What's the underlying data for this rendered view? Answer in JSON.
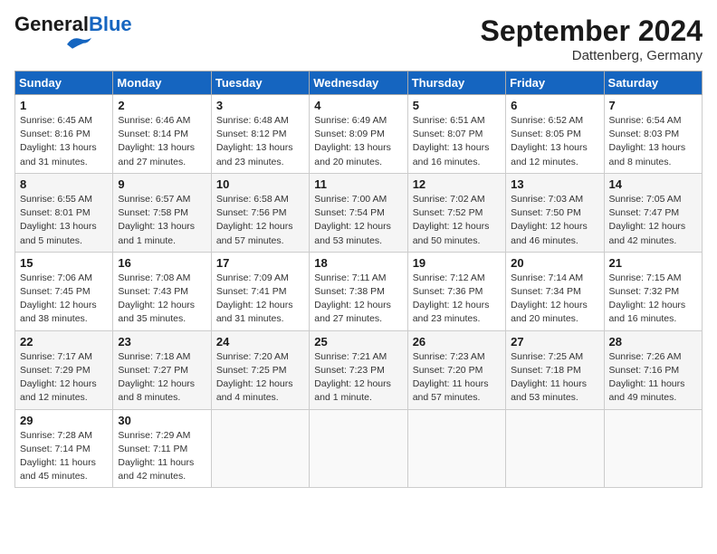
{
  "header": {
    "logo_general": "General",
    "logo_blue": "Blue",
    "month": "September 2024",
    "location": "Dattenberg, Germany"
  },
  "days_of_week": [
    "Sunday",
    "Monday",
    "Tuesday",
    "Wednesday",
    "Thursday",
    "Friday",
    "Saturday"
  ],
  "weeks": [
    [
      {
        "day": 1,
        "sunrise": "6:45 AM",
        "sunset": "8:16 PM",
        "daylight": "13 hours and 31 minutes."
      },
      {
        "day": 2,
        "sunrise": "6:46 AM",
        "sunset": "8:14 PM",
        "daylight": "13 hours and 27 minutes."
      },
      {
        "day": 3,
        "sunrise": "6:48 AM",
        "sunset": "8:12 PM",
        "daylight": "13 hours and 23 minutes."
      },
      {
        "day": 4,
        "sunrise": "6:49 AM",
        "sunset": "8:09 PM",
        "daylight": "13 hours and 20 minutes."
      },
      {
        "day": 5,
        "sunrise": "6:51 AM",
        "sunset": "8:07 PM",
        "daylight": "13 hours and 16 minutes."
      },
      {
        "day": 6,
        "sunrise": "6:52 AM",
        "sunset": "8:05 PM",
        "daylight": "13 hours and 12 minutes."
      },
      {
        "day": 7,
        "sunrise": "6:54 AM",
        "sunset": "8:03 PM",
        "daylight": "13 hours and 8 minutes."
      }
    ],
    [
      {
        "day": 8,
        "sunrise": "6:55 AM",
        "sunset": "8:01 PM",
        "daylight": "13 hours and 5 minutes."
      },
      {
        "day": 9,
        "sunrise": "6:57 AM",
        "sunset": "7:58 PM",
        "daylight": "13 hours and 1 minute."
      },
      {
        "day": 10,
        "sunrise": "6:58 AM",
        "sunset": "7:56 PM",
        "daylight": "12 hours and 57 minutes."
      },
      {
        "day": 11,
        "sunrise": "7:00 AM",
        "sunset": "7:54 PM",
        "daylight": "12 hours and 53 minutes."
      },
      {
        "day": 12,
        "sunrise": "7:02 AM",
        "sunset": "7:52 PM",
        "daylight": "12 hours and 50 minutes."
      },
      {
        "day": 13,
        "sunrise": "7:03 AM",
        "sunset": "7:50 PM",
        "daylight": "12 hours and 46 minutes."
      },
      {
        "day": 14,
        "sunrise": "7:05 AM",
        "sunset": "7:47 PM",
        "daylight": "12 hours and 42 minutes."
      }
    ],
    [
      {
        "day": 15,
        "sunrise": "7:06 AM",
        "sunset": "7:45 PM",
        "daylight": "12 hours and 38 minutes."
      },
      {
        "day": 16,
        "sunrise": "7:08 AM",
        "sunset": "7:43 PM",
        "daylight": "12 hours and 35 minutes."
      },
      {
        "day": 17,
        "sunrise": "7:09 AM",
        "sunset": "7:41 PM",
        "daylight": "12 hours and 31 minutes."
      },
      {
        "day": 18,
        "sunrise": "7:11 AM",
        "sunset": "7:38 PM",
        "daylight": "12 hours and 27 minutes."
      },
      {
        "day": 19,
        "sunrise": "7:12 AM",
        "sunset": "7:36 PM",
        "daylight": "12 hours and 23 minutes."
      },
      {
        "day": 20,
        "sunrise": "7:14 AM",
        "sunset": "7:34 PM",
        "daylight": "12 hours and 20 minutes."
      },
      {
        "day": 21,
        "sunrise": "7:15 AM",
        "sunset": "7:32 PM",
        "daylight": "12 hours and 16 minutes."
      }
    ],
    [
      {
        "day": 22,
        "sunrise": "7:17 AM",
        "sunset": "7:29 PM",
        "daylight": "12 hours and 12 minutes."
      },
      {
        "day": 23,
        "sunrise": "7:18 AM",
        "sunset": "7:27 PM",
        "daylight": "12 hours and 8 minutes."
      },
      {
        "day": 24,
        "sunrise": "7:20 AM",
        "sunset": "7:25 PM",
        "daylight": "12 hours and 4 minutes."
      },
      {
        "day": 25,
        "sunrise": "7:21 AM",
        "sunset": "7:23 PM",
        "daylight": "12 hours and 1 minute."
      },
      {
        "day": 26,
        "sunrise": "7:23 AM",
        "sunset": "7:20 PM",
        "daylight": "11 hours and 57 minutes."
      },
      {
        "day": 27,
        "sunrise": "7:25 AM",
        "sunset": "7:18 PM",
        "daylight": "11 hours and 53 minutes."
      },
      {
        "day": 28,
        "sunrise": "7:26 AM",
        "sunset": "7:16 PM",
        "daylight": "11 hours and 49 minutes."
      }
    ],
    [
      {
        "day": 29,
        "sunrise": "7:28 AM",
        "sunset": "7:14 PM",
        "daylight": "11 hours and 45 minutes."
      },
      {
        "day": 30,
        "sunrise": "7:29 AM",
        "sunset": "7:11 PM",
        "daylight": "11 hours and 42 minutes."
      },
      null,
      null,
      null,
      null,
      null
    ]
  ]
}
